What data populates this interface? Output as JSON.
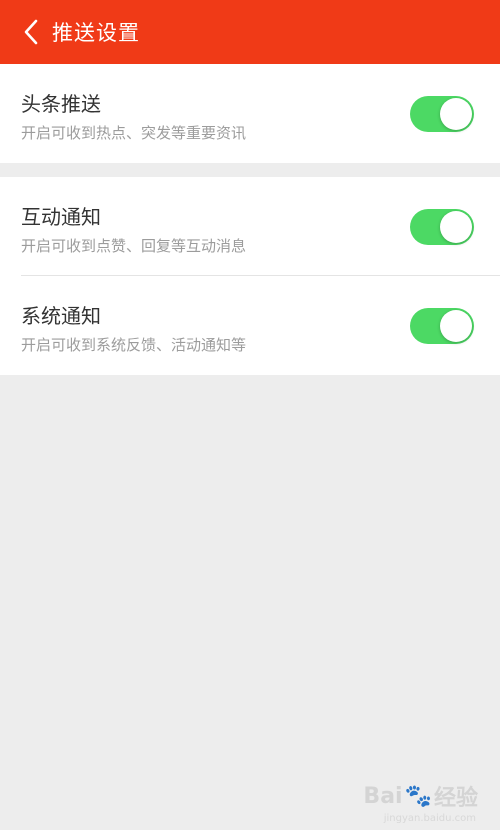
{
  "header": {
    "back_icon": "chevron-left-icon",
    "title": "推送设置"
  },
  "colors": {
    "header_bg": "#f03a17",
    "toggle_on": "#4cd964",
    "page_bg": "#ededed"
  },
  "settings": [
    {
      "title": "头条推送",
      "description": "开启可收到热点、突发等重要资讯",
      "enabled": true
    },
    {
      "title": "互动通知",
      "description": "开启可收到点赞、回复等互动消息",
      "enabled": true
    },
    {
      "title": "系统通知",
      "description": "开启可收到系统反馈、活动通知等",
      "enabled": true
    }
  ],
  "watermark": {
    "brand_left": "Bai",
    "brand_right": "经验",
    "url": "jingyan.baidu.com"
  }
}
